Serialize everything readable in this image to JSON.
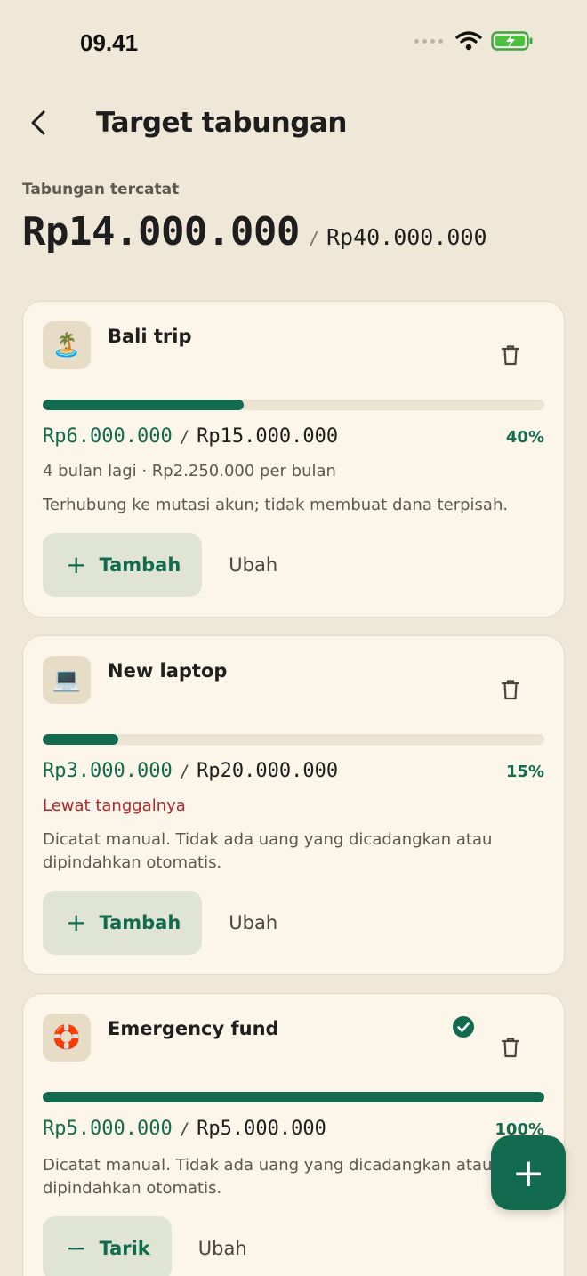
{
  "status": {
    "time": "09.41"
  },
  "header": {
    "title": "Target tabungan"
  },
  "summary": {
    "label": "Tabungan tercatat",
    "saved": "Rp14.000.000",
    "separator": "/",
    "target": "Rp40.000.000"
  },
  "goals": [
    {
      "emoji": "🏝️",
      "name": "Bali trip",
      "progress": 0.4,
      "saved": "Rp6.000.000",
      "separator": "/",
      "target": "Rp15.000.000",
      "percent": "40%",
      "schedule": "4 bulan lagi · Rp2.250.000 per bulan",
      "note": "Terhubung ke mutasi akun; tidak membuat dana terpisah.",
      "primary_icon": "+",
      "primary_label": "Tambah",
      "secondary_label": "Ubah"
    },
    {
      "emoji": "💻",
      "name": "New laptop",
      "progress": 0.15,
      "saved": "Rp3.000.000",
      "separator": "/",
      "target": "Rp20.000.000",
      "percent": "15%",
      "schedule": "Lewat tanggalnya",
      "note": "Dicatat manual. Tidak ada uang yang dicadangkan atau dipindahkan otomatis.",
      "primary_icon": "+",
      "primary_label": "Tambah",
      "secondary_label": "Ubah"
    },
    {
      "emoji": "🛟",
      "name": "Emergency fund",
      "progress": 1.0,
      "saved": "Rp5.000.000",
      "separator": "/",
      "target": "Rp5.000.000",
      "percent": "100%",
      "note": "Dicatat manual. Tidak ada uang yang dicadangkan atau dipindahkan otomatis.",
      "primary_icon": "−",
      "primary_label": "Tarik",
      "secondary_label": "Ubah",
      "completed": true
    }
  ],
  "fab": {
    "icon": "+"
  },
  "colors": {
    "background": "#efe7d7",
    "card": "#fcf6ea",
    "accent": "#136b4f",
    "warning": "#b3262b",
    "track": "#ece4d3"
  }
}
